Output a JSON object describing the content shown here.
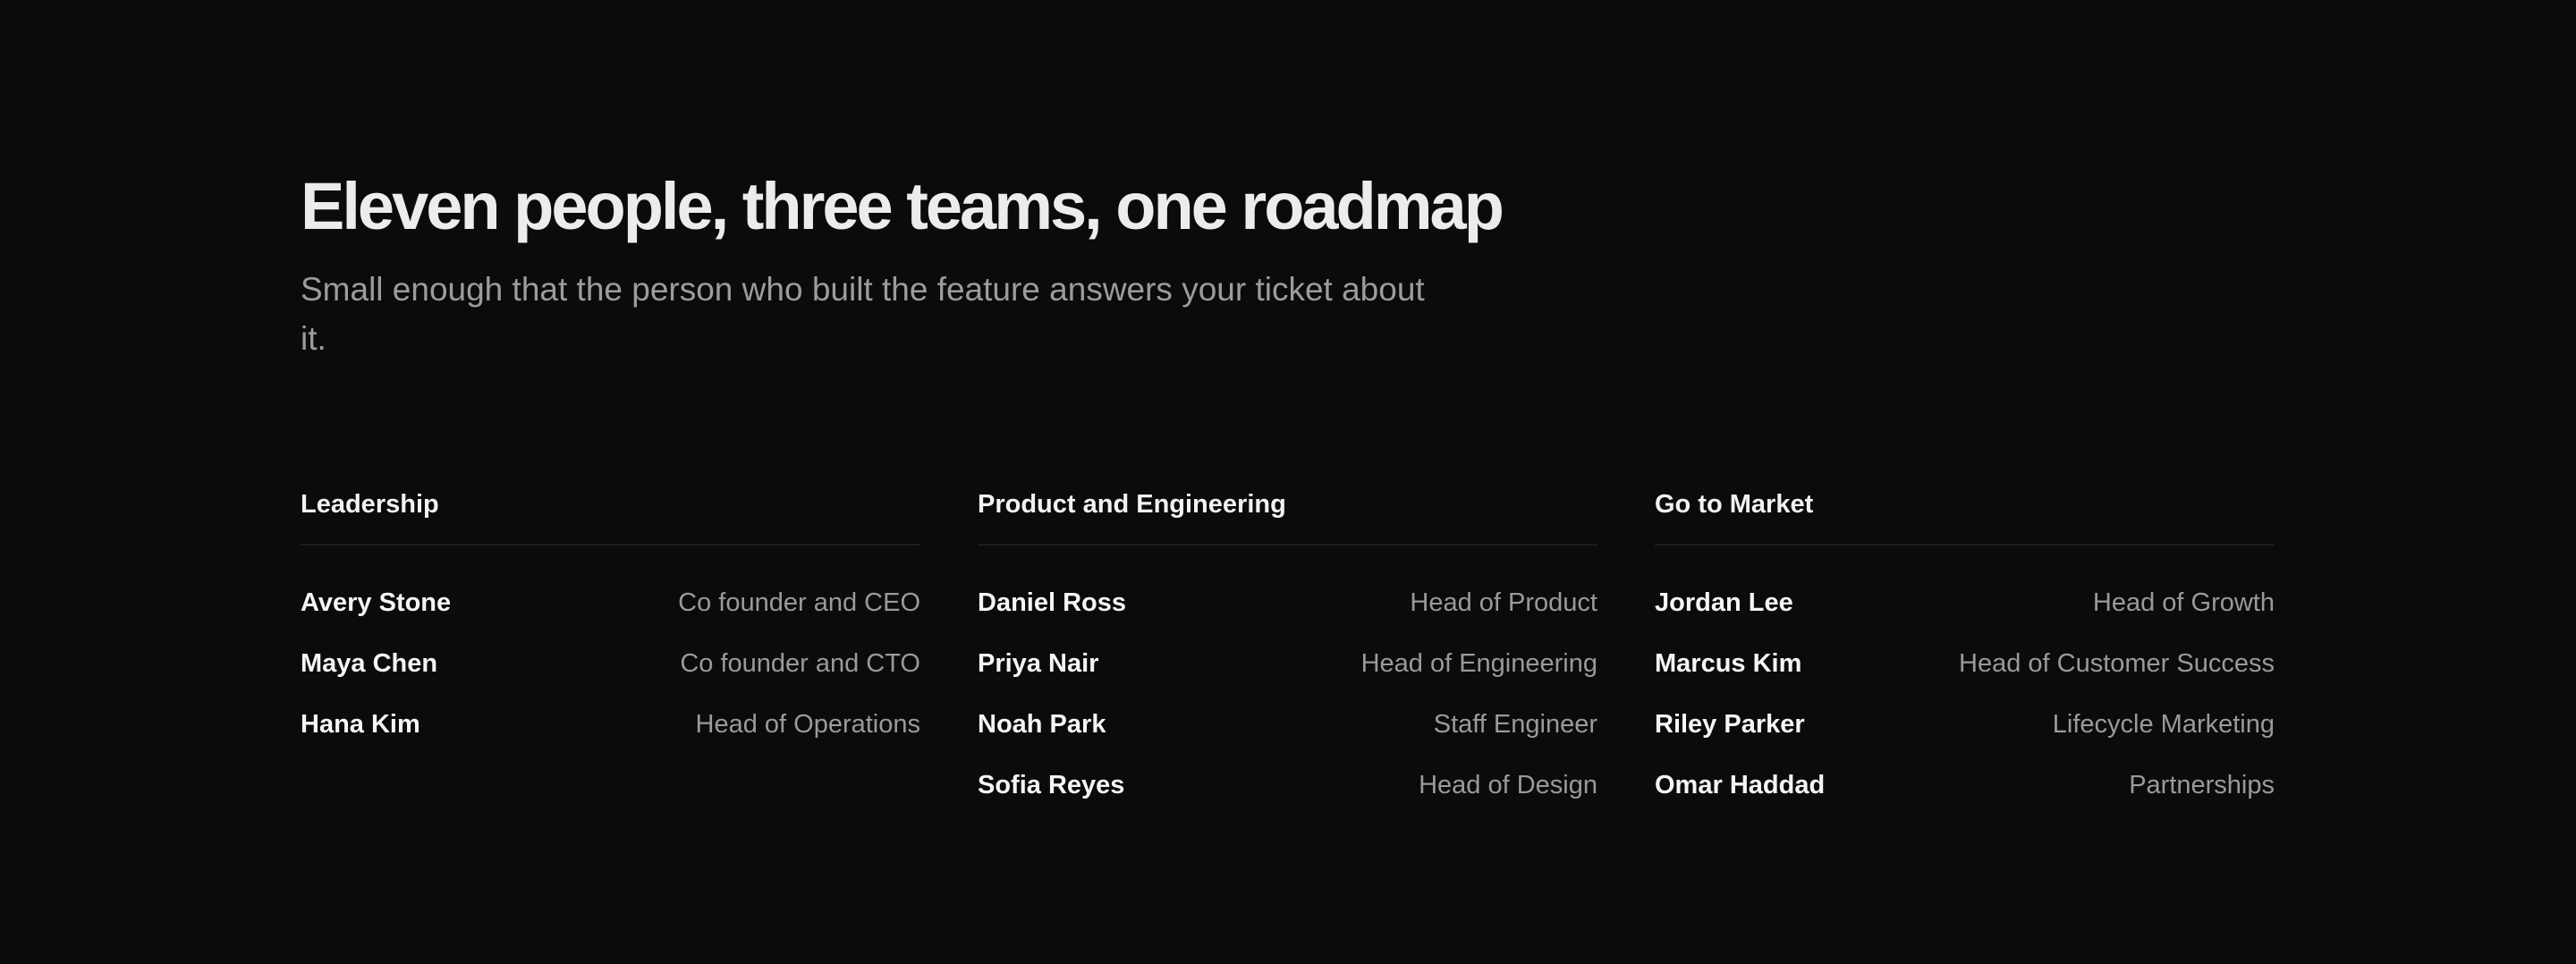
{
  "heading": {
    "title": "Eleven people, three teams, one roadmap",
    "subtitle": "Small enough that the person who built the feature answers your ticket about it."
  },
  "teams": [
    {
      "name": "Leadership",
      "members": [
        {
          "name": "Avery Stone",
          "role": "Co founder and CEO"
        },
        {
          "name": "Maya Chen",
          "role": "Co founder and CTO"
        },
        {
          "name": "Hana Kim",
          "role": "Head of Operations"
        }
      ]
    },
    {
      "name": "Product and Engineering",
      "members": [
        {
          "name": "Daniel Ross",
          "role": "Head of Product"
        },
        {
          "name": "Priya Nair",
          "role": "Head of Engineering"
        },
        {
          "name": "Noah Park",
          "role": "Staff Engineer"
        },
        {
          "name": "Sofia Reyes",
          "role": "Head of Design"
        }
      ]
    },
    {
      "name": "Go to Market",
      "members": [
        {
          "name": "Jordan Lee",
          "role": "Head of Growth"
        },
        {
          "name": "Marcus Kim",
          "role": "Head of Customer Success"
        },
        {
          "name": "Riley Parker",
          "role": "Lifecycle Marketing"
        },
        {
          "name": "Omar Haddad",
          "role": "Partnerships"
        }
      ]
    }
  ]
}
